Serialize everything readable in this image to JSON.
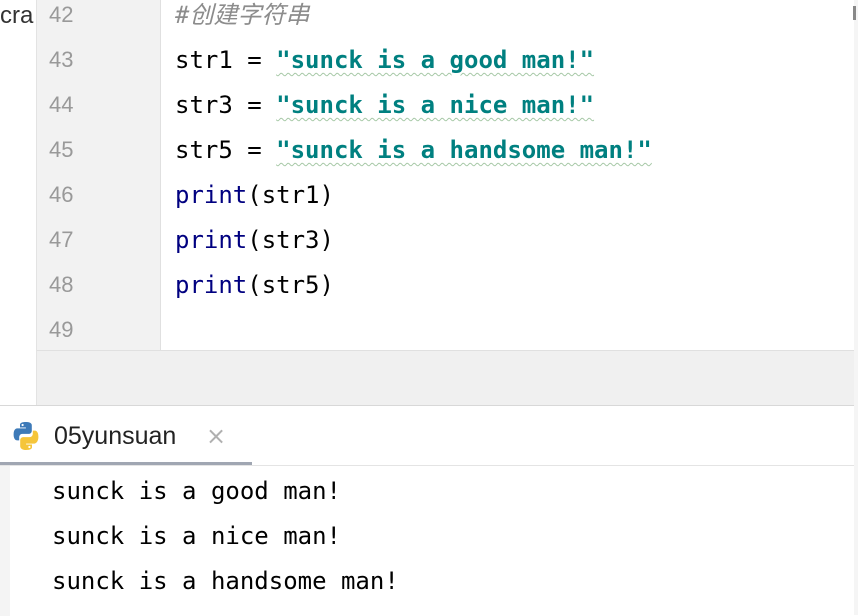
{
  "left_strip_text": "cra",
  "editor": {
    "lines": [
      {
        "num": "42",
        "kind": "comment",
        "text": "#创建字符串"
      },
      {
        "num": "43",
        "kind": "assign",
        "var": "str1 = ",
        "str": "\"sunck is a good man!\""
      },
      {
        "num": "44",
        "kind": "assign",
        "var": "str3 = ",
        "str": "\"sunck is a nice man!\""
      },
      {
        "num": "45",
        "kind": "assign",
        "var": "str5 = ",
        "str": "\"sunck is a handsome man!\""
      },
      {
        "num": "46",
        "kind": "call",
        "fn": "print",
        "args": "(str1)"
      },
      {
        "num": "47",
        "kind": "call",
        "fn": "print",
        "args": "(str3)"
      },
      {
        "num": "48",
        "kind": "call",
        "fn": "print",
        "args": "(str5)"
      },
      {
        "num": "49",
        "kind": "empty"
      }
    ]
  },
  "run_panel": {
    "tab_label": "05yunsuan",
    "tab_icon": "python-icon",
    "close_glyph": "×",
    "output": [
      "sunck is a good man!",
      "sunck is a nice man!",
      "sunck is a handsome man!"
    ]
  },
  "colors": {
    "keyword": "#000080",
    "string": "#008080",
    "comment": "#8c8c8c",
    "line_number": "#999999",
    "gutter_bg": "#f2f2f2"
  }
}
